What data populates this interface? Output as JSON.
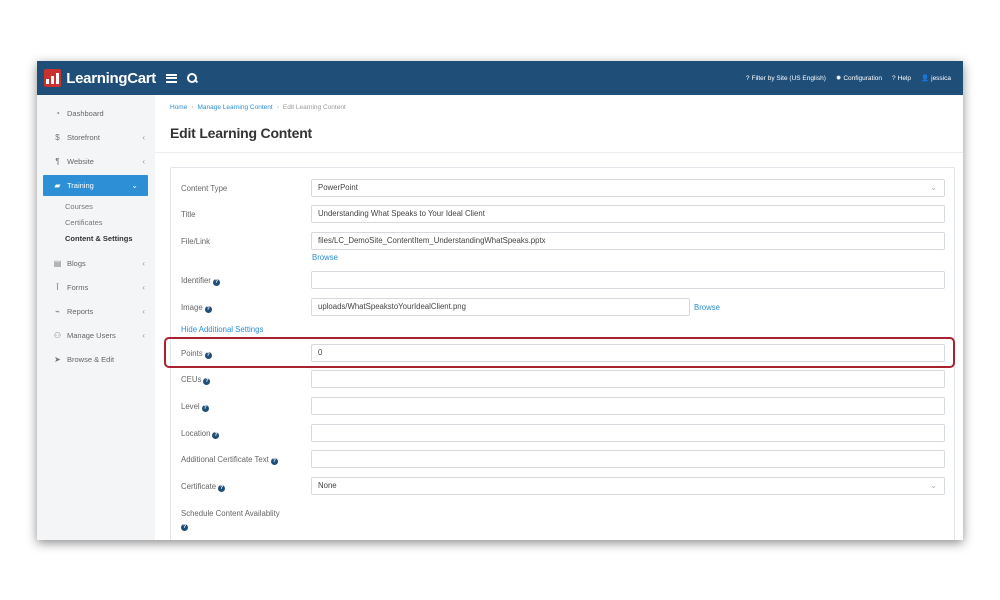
{
  "brand": {
    "name": "LearningCart"
  },
  "topbar": {
    "filter_label": "Filter by Site (US English)",
    "configuration_label": "Configuration",
    "help_label": "Help",
    "user_label": "jessica"
  },
  "sidebar": {
    "items": [
      {
        "label": "Dashboard",
        "icon": "dashboard-icon"
      },
      {
        "label": "Storefront",
        "icon": "dollar-icon"
      },
      {
        "label": "Website",
        "icon": "paragraph-icon"
      },
      {
        "label": "Training",
        "icon": "graduation-cap-icon"
      },
      {
        "label": "Blogs",
        "icon": "newspaper-icon"
      },
      {
        "label": "Forms",
        "icon": "forms-icon"
      },
      {
        "label": "Reports",
        "icon": "chart-icon"
      },
      {
        "label": "Manage Users",
        "icon": "users-icon"
      },
      {
        "label": "Browse & Edit",
        "icon": "pointer-icon"
      }
    ],
    "training_sub": [
      "Courses",
      "Certificates",
      "Content & Settings"
    ]
  },
  "breadcrumb": {
    "home": "Home",
    "manage": "Manage Learning Content",
    "current": "Edit Learning Content"
  },
  "page_title": "Edit Learning Content",
  "form": {
    "content_type": {
      "label": "Content Type",
      "value": "PowerPoint"
    },
    "title": {
      "label": "Title",
      "value": "Understanding What Speaks to Your Ideal Client"
    },
    "file_link": {
      "label": "File/Link",
      "value": "files/LC_DemoSite_ContentItem_UnderstandingWhatSpeaks.pptx",
      "browse": "Browse"
    },
    "identifier": {
      "label": "Identifier",
      "value": ""
    },
    "image": {
      "label": "Image",
      "value": "uploads/WhatSpeakstoYourIdealClient.png",
      "browse": "Browse"
    },
    "hide_settings": "Hide Additional Settings",
    "points": {
      "label": "Points",
      "value": "0"
    },
    "ceus": {
      "label": "CEUs",
      "value": ""
    },
    "level": {
      "label": "Level",
      "value": ""
    },
    "location": {
      "label": "Location",
      "value": ""
    },
    "additional_cert": {
      "label": "Additional Certificate Text",
      "value": ""
    },
    "certificate": {
      "label": "Certificate",
      "value": "None"
    },
    "schedule": {
      "label": "Schedule Content Availablity"
    }
  },
  "colors": {
    "topbar": "#1f4e79",
    "accent": "#2d8fd5",
    "logo": "#c9322f",
    "highlight": "#a8232f"
  }
}
